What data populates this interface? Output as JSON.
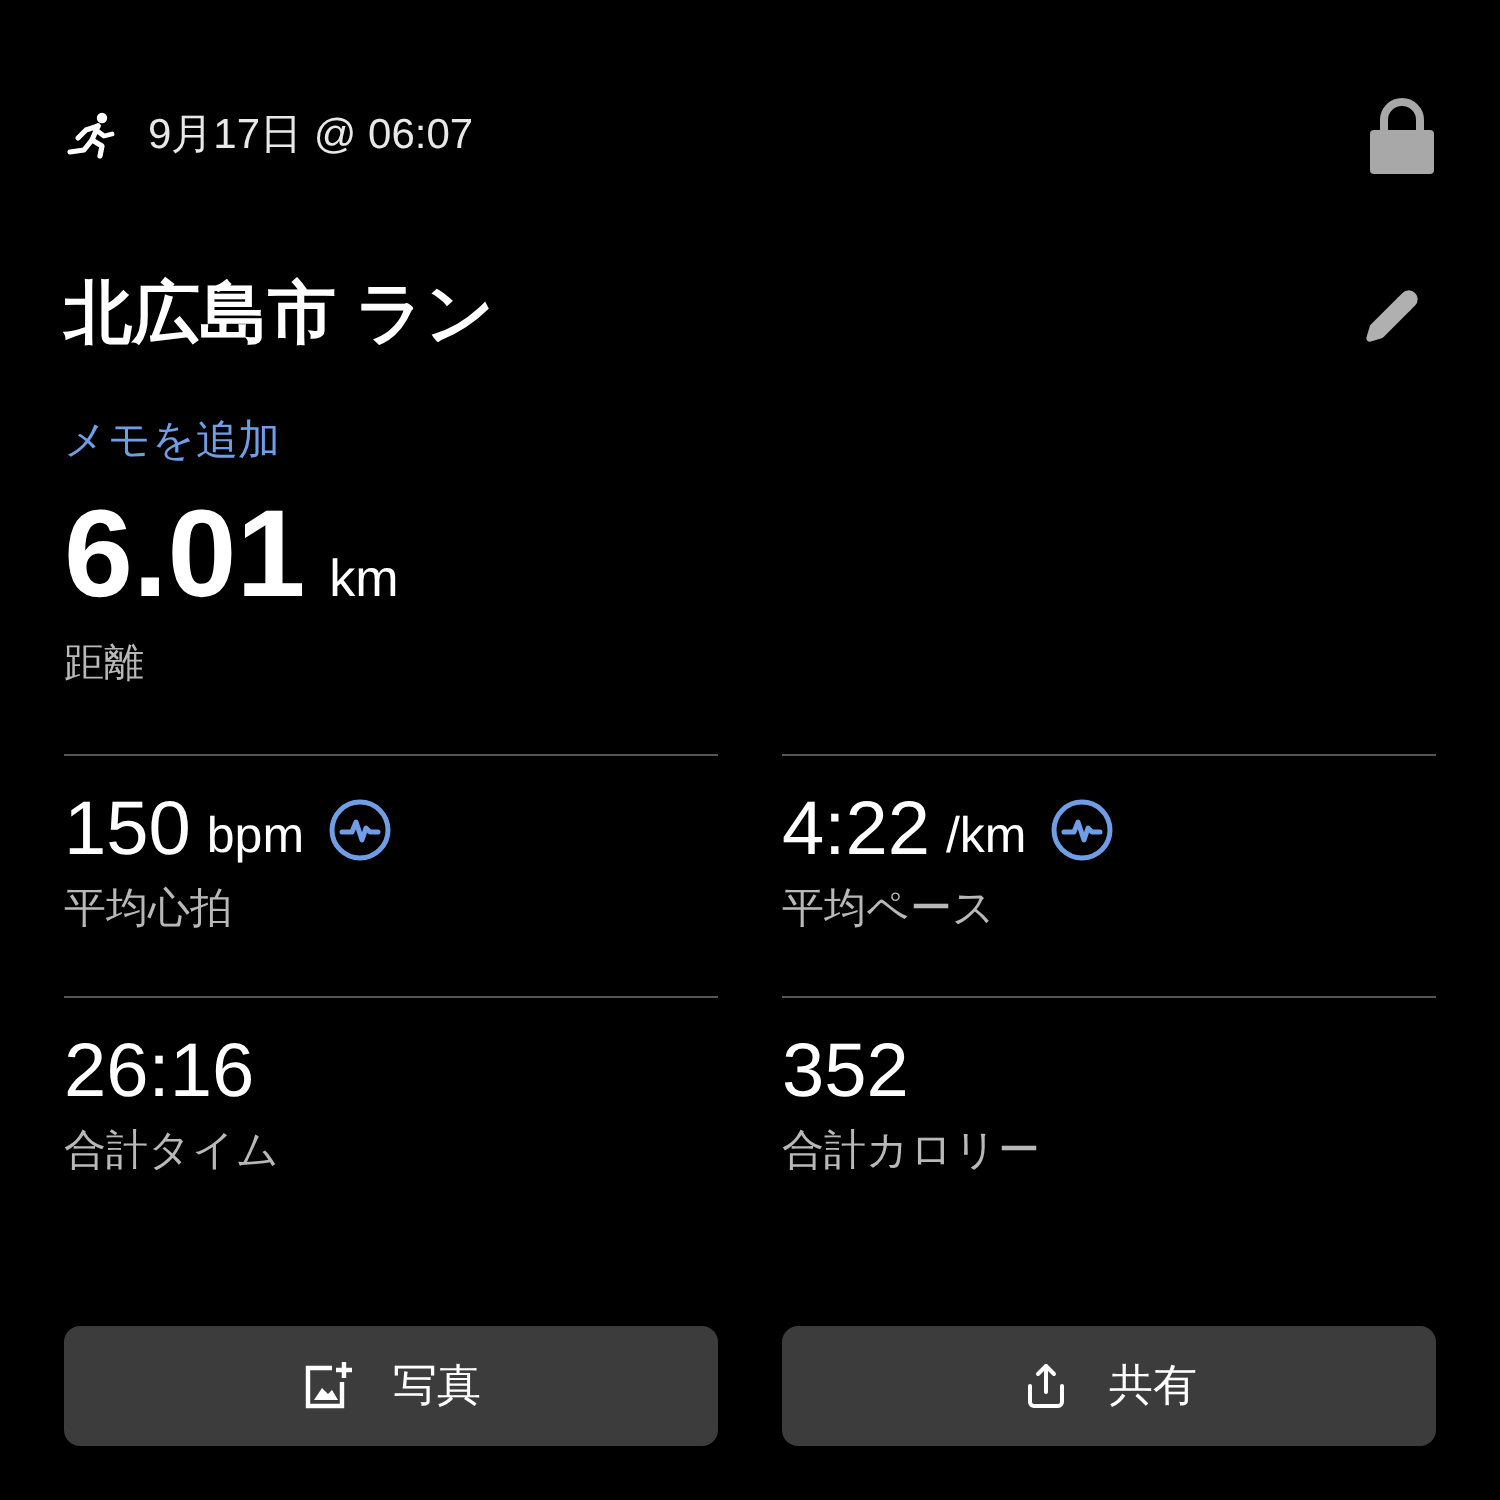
{
  "header": {
    "date": "9月17日 @ 06:07",
    "locked": true
  },
  "title": "北広島市 ラン",
  "memo_link": "メモを追加",
  "distance": {
    "value": "6.01",
    "unit": "km",
    "label": "距離"
  },
  "stats": [
    {
      "value": "150",
      "unit": "bpm",
      "label": "平均心拍",
      "chart_link": true
    },
    {
      "value": "4:22",
      "unit": "/km",
      "label": "平均ペース",
      "chart_link": true
    },
    {
      "value": "26:16",
      "label": "合計タイム",
      "chart_link": false
    },
    {
      "value": "352",
      "label": "合計カロリー",
      "chart_link": false
    }
  ],
  "buttons": [
    {
      "kind": "photo",
      "label": "写真"
    },
    {
      "kind": "share",
      "label": "共有"
    }
  ]
}
